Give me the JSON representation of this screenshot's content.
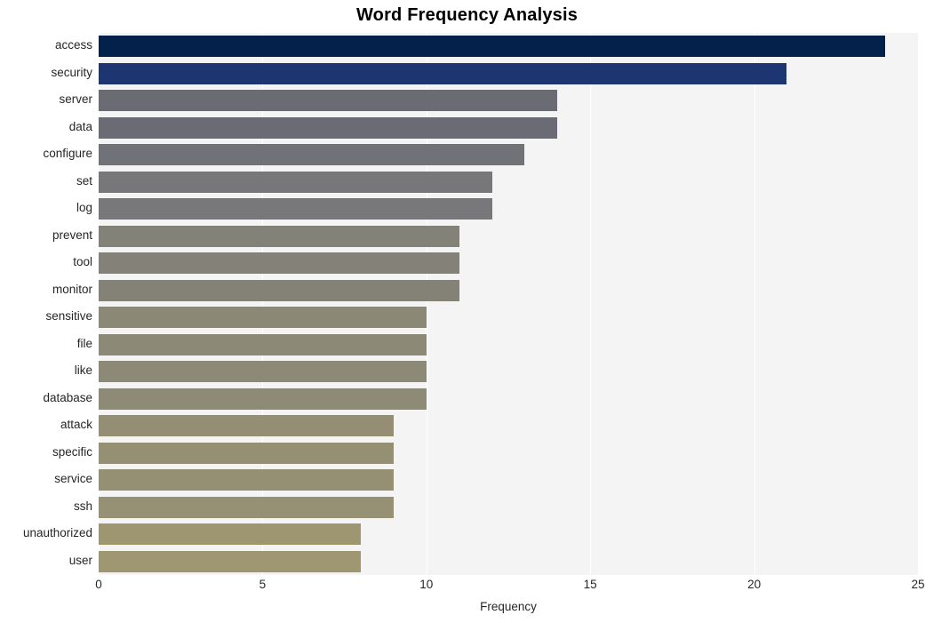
{
  "chart_data": {
    "type": "bar",
    "orientation": "horizontal",
    "title": "Word Frequency Analysis",
    "xlabel": "Frequency",
    "ylabel": "",
    "xlim": [
      0,
      25
    ],
    "xticks": [
      0,
      5,
      10,
      15,
      20,
      25
    ],
    "xticklabels": [
      "0",
      "5",
      "10",
      "15",
      "20",
      "25"
    ],
    "grid": true,
    "grid_axis": "x",
    "legend": null,
    "categories": [
      "access",
      "security",
      "server",
      "data",
      "configure",
      "set",
      "log",
      "prevent",
      "tool",
      "monitor",
      "sensitive",
      "file",
      "like",
      "database",
      "attack",
      "specific",
      "service",
      "ssh",
      "unauthorized",
      "user"
    ],
    "values": [
      24,
      21,
      14,
      14,
      13,
      12,
      12,
      11,
      11,
      11,
      10,
      10,
      10,
      10,
      9,
      9,
      9,
      9,
      8,
      8
    ],
    "bar_colors": [
      "#04214c",
      "#1d3571",
      "#6a6b73",
      "#6a6b74",
      "#717278",
      "#77777a",
      "#78787b",
      "#838279",
      "#848278",
      "#848277",
      "#8b8876",
      "#8c8976",
      "#8c8976",
      "#8d8a76",
      "#948f74",
      "#958f74",
      "#958f74",
      "#969074",
      "#9d9671",
      "#9e9771"
    ],
    "background_color": "#f4f4f5",
    "gridline_color": "#ffffff",
    "text_color": "#262626"
  }
}
